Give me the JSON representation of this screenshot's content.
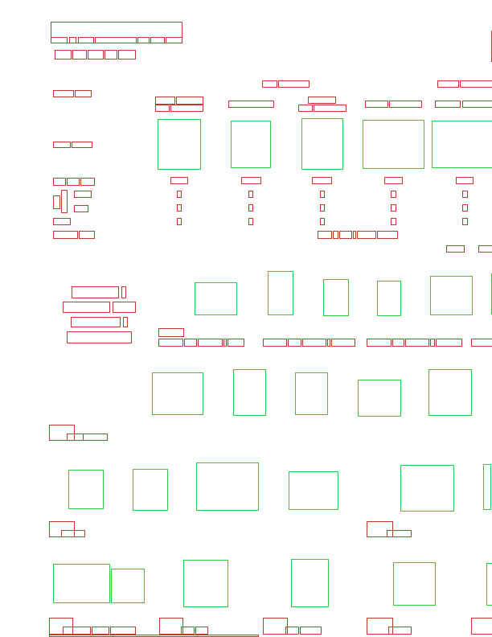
{
  "page": {
    "kind": "layout-region-diagram",
    "text_region_color": "#c0392b",
    "figure_region_color": "#2ecc40"
  },
  "regions": {
    "text": [
      [
        63,
        27,
        226,
        53
      ],
      [
        63,
        46,
        83,
        53
      ],
      [
        86,
        46,
        94,
        53
      ],
      [
        97,
        46,
        116,
        53
      ],
      [
        118,
        46,
        169,
        53
      ],
      [
        171,
        46,
        185,
        53
      ],
      [
        187,
        46,
        204,
        53
      ],
      [
        206,
        46,
        226,
        53
      ],
      [
        68,
        62,
        88,
        73
      ],
      [
        90,
        62,
        107,
        73
      ],
      [
        109,
        62,
        128,
        73
      ],
      [
        130,
        62,
        145,
        73
      ],
      [
        147,
        62,
        168,
        73
      ],
      [
        611,
        38,
        614,
        76
      ],
      [
        326,
        100,
        344,
        108
      ],
      [
        346,
        100,
        384,
        108
      ],
      [
        544,
        100,
        570,
        108
      ],
      [
        572,
        100,
        612,
        108
      ],
      [
        66,
        112,
        91,
        120
      ],
      [
        93,
        112,
        113,
        120
      ],
      [
        193,
        120,
        217,
        129
      ],
      [
        219,
        120,
        252,
        129
      ],
      [
        193,
        130,
        210,
        138
      ],
      [
        212,
        130,
        252,
        138
      ],
      [
        284,
        125,
        340,
        133
      ],
      [
        383,
        120,
        417,
        128
      ],
      [
        371,
        130,
        388,
        138
      ],
      [
        390,
        130,
        430,
        138
      ],
      [
        454,
        125,
        482,
        133
      ],
      [
        484,
        125,
        524,
        133
      ],
      [
        541,
        125,
        572,
        133
      ],
      [
        575,
        125,
        612,
        133
      ],
      [
        66,
        176,
        87,
        183
      ],
      [
        89,
        176,
        114,
        183
      ],
      [
        66,
        221,
        81,
        230
      ],
      [
        83,
        221,
        98,
        230
      ],
      [
        100,
        221,
        117,
        230
      ],
      [
        212,
        220,
        233,
        228
      ],
      [
        300,
        220,
        324,
        228
      ],
      [
        388,
        220,
        412,
        228
      ],
      [
        478,
        220,
        500,
        228
      ],
      [
        567,
        220,
        588,
        228
      ],
      [
        66,
        243,
        74,
        259
      ],
      [
        76,
        236,
        83,
        264
      ],
      [
        92,
        237,
        113,
        245
      ],
      [
        92,
        255,
        109,
        263
      ],
      [
        220,
        237,
        225,
        245
      ],
      [
        220,
        254,
        225,
        262
      ],
      [
        220,
        271,
        225,
        279
      ],
      [
        309,
        237,
        314,
        245
      ],
      [
        309,
        254,
        314,
        262
      ],
      [
        309,
        271,
        314,
        279
      ],
      [
        398,
        237,
        403,
        245
      ],
      [
        398,
        254,
        403,
        262
      ],
      [
        398,
        271,
        403,
        279
      ],
      [
        486,
        237,
        492,
        245
      ],
      [
        486,
        254,
        492,
        262
      ],
      [
        486,
        271,
        492,
        279
      ],
      [
        575,
        237,
        581,
        245
      ],
      [
        575,
        254,
        581,
        262
      ],
      [
        575,
        271,
        581,
        279
      ],
      [
        66,
        271,
        87,
        279
      ],
      [
        66,
        287,
        96,
        296
      ],
      [
        98,
        287,
        117,
        296
      ],
      [
        395,
        287,
        412,
        296
      ],
      [
        414,
        287,
        420,
        296
      ],
      [
        422,
        287,
        437,
        296
      ],
      [
        439,
        287,
        442,
        296
      ],
      [
        444,
        287,
        467,
        296
      ],
      [
        469,
        287,
        494,
        296
      ],
      [
        555,
        305,
        577,
        313
      ],
      [
        595,
        305,
        612,
        313
      ],
      [
        89,
        356,
        147,
        370
      ],
      [
        151,
        356,
        156,
        370
      ],
      [
        78,
        375,
        136,
        388
      ],
      [
        140,
        375,
        168,
        388
      ],
      [
        88,
        394,
        149,
        406
      ],
      [
        153,
        394,
        158,
        406
      ],
      [
        83,
        412,
        163,
        426
      ],
      [
        197,
        408,
        228,
        418
      ],
      [
        197,
        421,
        227,
        430
      ],
      [
        229,
        421,
        244,
        430
      ],
      [
        246,
        421,
        276,
        430
      ],
      [
        278,
        421,
        281,
        430
      ],
      [
        283,
        421,
        303,
        430
      ],
      [
        327,
        421,
        356,
        430
      ],
      [
        358,
        421,
        374,
        430
      ],
      [
        376,
        421,
        405,
        430
      ],
      [
        407,
        421,
        410,
        430
      ],
      [
        412,
        421,
        441,
        430
      ],
      [
        456,
        421,
        486,
        430
      ],
      [
        488,
        421,
        502,
        430
      ],
      [
        504,
        421,
        533,
        430
      ],
      [
        535,
        421,
        540,
        430
      ],
      [
        542,
        421,
        574,
        430
      ],
      [
        586,
        421,
        612,
        430
      ],
      [
        61,
        528,
        92,
        547
      ],
      [
        83,
        539,
        103,
        547
      ],
      [
        103,
        539,
        133,
        547
      ],
      [
        61,
        648,
        92,
        667
      ],
      [
        76,
        659,
        105,
        667
      ],
      [
        456,
        648,
        488,
        667
      ],
      [
        481,
        659,
        511,
        667
      ],
      [
        61,
        768,
        90,
        788
      ],
      [
        78,
        779,
        112,
        788
      ],
      [
        114,
        779,
        135,
        788
      ],
      [
        137,
        779,
        168,
        788
      ],
      [
        198,
        768,
        227,
        788
      ],
      [
        225,
        779,
        241,
        788
      ],
      [
        243,
        779,
        258,
        788
      ],
      [
        327,
        768,
        357,
        788
      ],
      [
        355,
        779,
        371,
        788
      ],
      [
        373,
        779,
        399,
        788
      ],
      [
        456,
        768,
        488,
        788
      ],
      [
        483,
        779,
        511,
        788
      ],
      [
        586,
        768,
        612,
        788
      ],
      [
        61,
        789,
        321,
        791
      ]
    ],
    "figures": [
      [
        196,
        148,
        249,
        210
      ],
      [
        287,
        150,
        336,
        208
      ],
      [
        375,
        147,
        426,
        210
      ],
      [
        451,
        149,
        527,
        209
      ],
      [
        537,
        150,
        612,
        208
      ],
      [
        242,
        351,
        294,
        391
      ],
      [
        333,
        337,
        364,
        391
      ],
      [
        402,
        347,
        433,
        392
      ],
      [
        469,
        349,
        498,
        392
      ],
      [
        535,
        343,
        587,
        391
      ],
      [
        611,
        340,
        614,
        390
      ],
      [
        189,
        463,
        252,
        515
      ],
      [
        290,
        459,
        330,
        516
      ],
      [
        367,
        463,
        407,
        515
      ],
      [
        445,
        472,
        498,
        517
      ],
      [
        533,
        459,
        586,
        516
      ],
      [
        85,
        584,
        128,
        632
      ],
      [
        165,
        583,
        208,
        634
      ],
      [
        244,
        575,
        321,
        634
      ],
      [
        359,
        586,
        420,
        633
      ],
      [
        498,
        578,
        564,
        635
      ],
      [
        601,
        577,
        610,
        633
      ],
      [
        66,
        701,
        136,
        749
      ],
      [
        138,
        707,
        179,
        749
      ],
      [
        228,
        696,
        283,
        754
      ],
      [
        362,
        695,
        408,
        754
      ],
      [
        489,
        699,
        541,
        752
      ],
      [
        605,
        700,
        612,
        752
      ]
    ]
  }
}
